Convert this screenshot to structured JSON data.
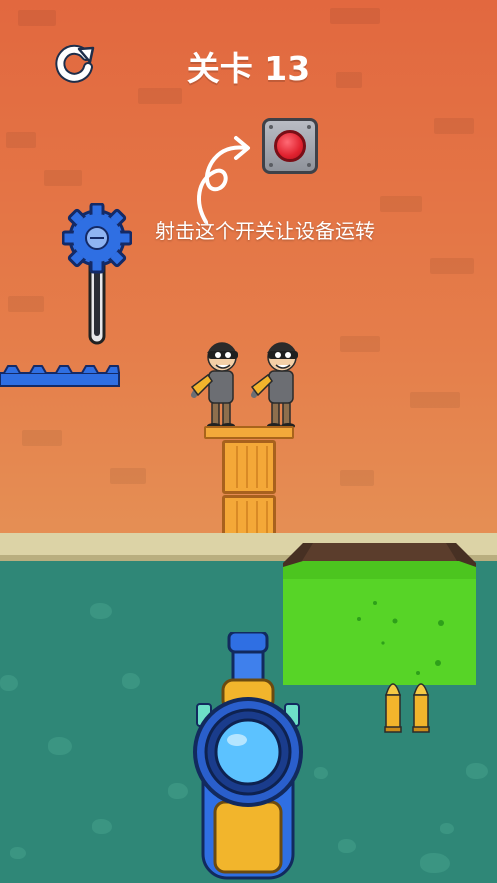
{
  "header": {
    "level_label": "关卡 13"
  },
  "hint": {
    "text": "射击这个开关让设备运转"
  },
  "icons": {
    "restart": "restart-icon",
    "switch": "red-switch-button",
    "gear": "blue-gear-icon",
    "bullet": "bullet-icon",
    "rifle": "sniper-rifle"
  },
  "level": {
    "targets": 2,
    "bullets_remaining": 2,
    "crates": 2
  },
  "colors": {
    "sky": "#e57d4a",
    "water": "#2f8777",
    "acid": "#57d427",
    "switch_red": "#e1222f",
    "gear_blue": "#2f6fe3",
    "crate": "#f4a838",
    "bullet": "#f2b52c"
  }
}
